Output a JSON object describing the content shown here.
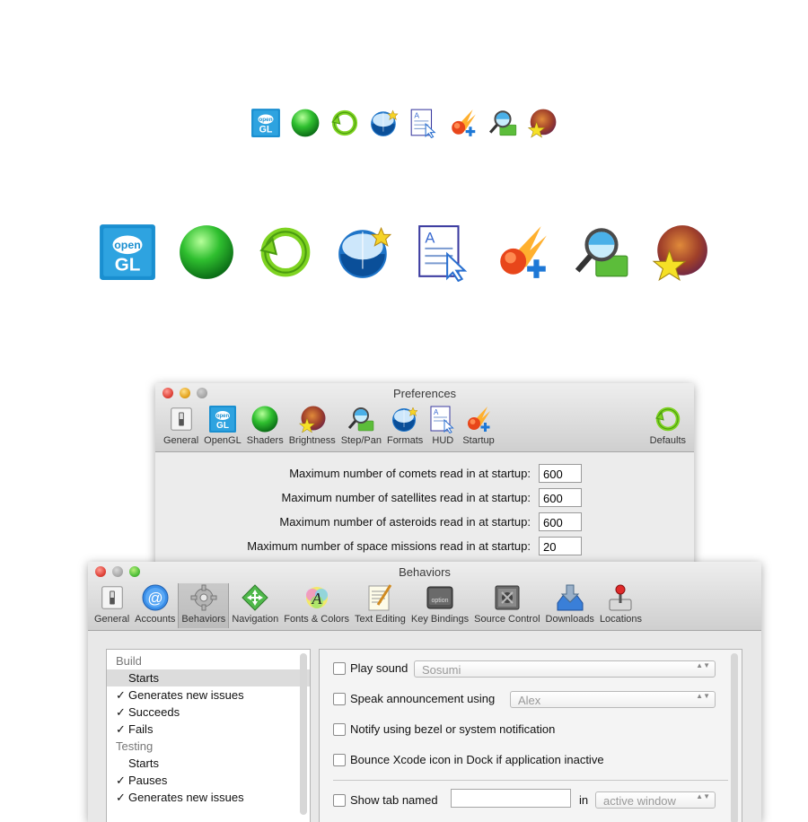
{
  "preferences": {
    "title": "Preferences",
    "toolbar": [
      "General",
      "OpenGL",
      "Shaders",
      "Brightness",
      "Step/Pan",
      "Formats",
      "HUD",
      "Startup"
    ],
    "defaults_label": "Defaults",
    "rows": [
      {
        "label": "Maximum number of comets read in at startup:",
        "value": "600"
      },
      {
        "label": "Maximum number of satellites read in at startup:",
        "value": "600"
      },
      {
        "label": "Maximum number of asteroids read in at startup:",
        "value": "600"
      },
      {
        "label": "Maximum number of space missions read in at startup:",
        "value": "20"
      }
    ]
  },
  "icons": {
    "opengl_text1": "open",
    "opengl_text2": "GL",
    "hud_letter": "A"
  },
  "behaviors": {
    "title": "Behaviors",
    "toolbar": [
      "General",
      "Accounts",
      "Behaviors",
      "Navigation",
      "Fonts & Colors",
      "Text Editing",
      "Key Bindings",
      "Source Control",
      "Downloads",
      "Locations"
    ],
    "sidebar": [
      {
        "text": "Build",
        "type": "header"
      },
      {
        "text": "Starts",
        "type": "selected"
      },
      {
        "text": "Generates new issues",
        "type": "checked"
      },
      {
        "text": "Succeeds",
        "type": "checked"
      },
      {
        "text": "Fails",
        "type": "checked"
      },
      {
        "text": "Testing",
        "type": "header"
      },
      {
        "text": "Starts",
        "type": "plain"
      },
      {
        "text": "Pauses",
        "type": "checked"
      },
      {
        "text": "Generates new issues",
        "type": "checked"
      }
    ],
    "check_mark": "✓",
    "play_sound": "Play sound",
    "sound_value": "Sosumi",
    "speak": "Speak announcement using",
    "voice_value": "Alex",
    "notify": "Notify using bezel or system notification",
    "bounce": "Bounce Xcode icon in Dock if application inactive",
    "show_tab": "Show tab named",
    "in_label": "in",
    "window_value": "active window",
    "popup_arrow": "▲▼"
  }
}
